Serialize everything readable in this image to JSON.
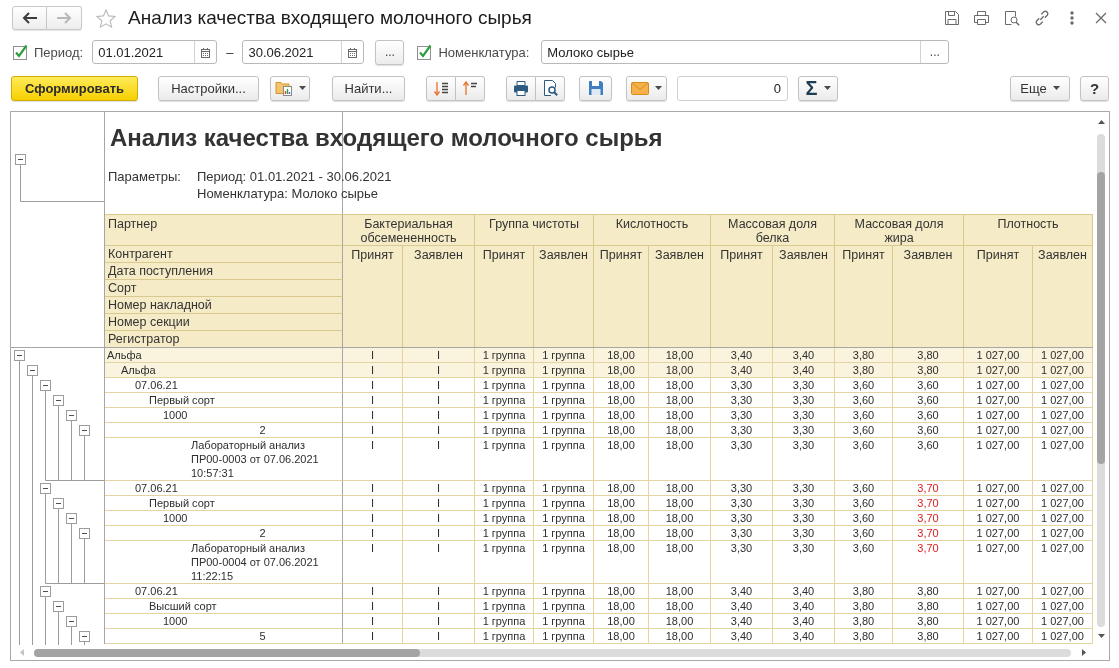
{
  "window": {
    "navigation": [
      {
        "kind": "back",
        "disabled": false
      },
      {
        "kind": "forward",
        "disabled": true
      }
    ],
    "favorite": false,
    "title": "Анализ качества входящего молочного сырья"
  },
  "filters": {
    "period": {
      "checked": true,
      "label": "Период:",
      "from": "01.01.2021",
      "separator": "–",
      "to": "30.06.2021",
      "choose_button": "..."
    },
    "nomenclature": {
      "checked": true,
      "label": "Номенклатура:",
      "value": "Молоко сырье",
      "choose_button": "..."
    }
  },
  "command_bar": {
    "generate_button": "Сформировать",
    "settings_button": "Настройки...",
    "find_button": "Найти...",
    "counter": "0",
    "sum_button": "Σ",
    "more_button": "Еще",
    "help_button": "?"
  },
  "report": {
    "title": "Анализ качества входящего молочного сырья",
    "parameters": {
      "expanded": true,
      "label": "Параметры:",
      "lines": [
        "Период: 01.01.2021 - 30.06.2021",
        "Номенклатура: Молоко сырье"
      ]
    },
    "group_header": "Партнер",
    "level_headers": [
      "Контрагент",
      "Дата поступления",
      "Сорт",
      "Номер накладной",
      "Номер секции",
      "Регистратор"
    ],
    "column_groups": [
      {
        "title": "Бактериальная обсемененность",
        "columns": [
          "Принят",
          "Заявлен"
        ]
      },
      {
        "title": "Группа чистоты",
        "columns": [
          "Принят",
          "Заявлен"
        ]
      },
      {
        "title": "Кислотность",
        "columns": [
          "Принят",
          "Заявлен"
        ]
      },
      {
        "title": "Массовая доля белка",
        "columns": [
          "Принят",
          "Заявлен"
        ]
      },
      {
        "title": "Массовая доля жира",
        "columns": [
          "Принят",
          "Заявлен"
        ]
      },
      {
        "title": "Плотность",
        "columns": [
          "Принят",
          "Заявлен"
        ]
      }
    ],
    "rows": [
      {
        "label": "Альфа",
        "expanded": true,
        "declared_fat_mismatch": false,
        "values": [
          "I",
          "I",
          "1 группа",
          "1 группа",
          "18,00",
          "18,00",
          "3,40",
          "3,40",
          "3,80",
          "3,80",
          "1 027,00",
          "1 027,00"
        ],
        "children": [
          {
            "label": "Альфа",
            "expanded": true,
            "declared_fat_mismatch": false,
            "values": [
              "I",
              "I",
              "1 группа",
              "1 группа",
              "18,00",
              "18,00",
              "3,40",
              "3,40",
              "3,80",
              "3,80",
              "1 027,00",
              "1 027,00"
            ],
            "children": [
              {
                "label": "07.06.21",
                "expanded": true,
                "declared_fat_mismatch": false,
                "values": [
                  "I",
                  "I",
                  "1 группа",
                  "1 группа",
                  "18,00",
                  "18,00",
                  "3,30",
                  "3,30",
                  "3,60",
                  "3,60",
                  "1 027,00",
                  "1 027,00"
                ],
                "children": [
                  {
                    "label": "Первый сорт",
                    "expanded": true,
                    "declared_fat_mismatch": false,
                    "values": [
                      "I",
                      "I",
                      "1 группа",
                      "1 группа",
                      "18,00",
                      "18,00",
                      "3,30",
                      "3,30",
                      "3,60",
                      "3,60",
                      "1 027,00",
                      "1 027,00"
                    ],
                    "children": [
                      {
                        "label": "1000",
                        "expanded": true,
                        "declared_fat_mismatch": false,
                        "values": [
                          "I",
                          "I",
                          "1 группа",
                          "1 группа",
                          "18,00",
                          "18,00",
                          "3,30",
                          "3,30",
                          "3,60",
                          "3,60",
                          "1 027,00",
                          "1 027,00"
                        ],
                        "children": [
                          {
                            "label": "2",
                            "expanded": true,
                            "declared_fat_mismatch": false,
                            "values": [
                              "I",
                              "I",
                              "1 группа",
                              "1 группа",
                              "18,00",
                              "18,00",
                              "3,30",
                              "3,30",
                              "3,60",
                              "3,60",
                              "1 027,00",
                              "1 027,00"
                            ],
                            "children": [
                              {
                                "label": "Лабораторный анализ ПР00-0003 от 07.06.2021 10:57:31",
                                "declared_fat_mismatch": false,
                                "values": [
                                  "I",
                                  "I",
                                  "1 группа",
                                  "1 группа",
                                  "18,00",
                                  "18,00",
                                  "3,30",
                                  "3,30",
                                  "3,60",
                                  "3,60",
                                  "1 027,00",
                                  "1 027,00"
                                ]
                              }
                            ]
                          }
                        ]
                      }
                    ]
                  }
                ]
              },
              {
                "label": "07.06.21",
                "expanded": true,
                "declared_fat_mismatch": true,
                "values": [
                  "I",
                  "I",
                  "1 группа",
                  "1 группа",
                  "18,00",
                  "18,00",
                  "3,30",
                  "3,30",
                  "3,60",
                  "3,70",
                  "1 027,00",
                  "1 027,00"
                ],
                "children": [
                  {
                    "label": "Первый сорт",
                    "expanded": true,
                    "declared_fat_mismatch": true,
                    "values": [
                      "I",
                      "I",
                      "1 группа",
                      "1 группа",
                      "18,00",
                      "18,00",
                      "3,30",
                      "3,30",
                      "3,60",
                      "3,70",
                      "1 027,00",
                      "1 027,00"
                    ],
                    "children": [
                      {
                        "label": "1000",
                        "expanded": true,
                        "declared_fat_mismatch": true,
                        "values": [
                          "I",
                          "I",
                          "1 группа",
                          "1 группа",
                          "18,00",
                          "18,00",
                          "3,30",
                          "3,30",
                          "3,60",
                          "3,70",
                          "1 027,00",
                          "1 027,00"
                        ],
                        "children": [
                          {
                            "label": "2",
                            "expanded": true,
                            "declared_fat_mismatch": true,
                            "values": [
                              "I",
                              "I",
                              "1 группа",
                              "1 группа",
                              "18,00",
                              "18,00",
                              "3,30",
                              "3,30",
                              "3,60",
                              "3,70",
                              "1 027,00",
                              "1 027,00"
                            ],
                            "children": [
                              {
                                "label": "Лабораторный анализ ПР00-0004 от 07.06.2021 11:22:15",
                                "declared_fat_mismatch": true,
                                "values": [
                                  "I",
                                  "I",
                                  "1 группа",
                                  "1 группа",
                                  "18,00",
                                  "18,00",
                                  "3,30",
                                  "3,30",
                                  "3,60",
                                  "3,70",
                                  "1 027,00",
                                  "1 027,00"
                                ]
                              }
                            ]
                          }
                        ]
                      }
                    ]
                  }
                ]
              },
              {
                "label": "07.06.21",
                "expanded": true,
                "declared_fat_mismatch": false,
                "values": [
                  "I",
                  "I",
                  "1 группа",
                  "1 группа",
                  "18,00",
                  "18,00",
                  "3,40",
                  "3,40",
                  "3,80",
                  "3,80",
                  "1 027,00",
                  "1 027,00"
                ],
                "children": [
                  {
                    "label": "Высший сорт",
                    "expanded": true,
                    "declared_fat_mismatch": false,
                    "values": [
                      "I",
                      "I",
                      "1 группа",
                      "1 группа",
                      "18,00",
                      "18,00",
                      "3,40",
                      "3,40",
                      "3,80",
                      "3,80",
                      "1 027,00",
                      "1 027,00"
                    ],
                    "children": [
                      {
                        "label": "1000",
                        "expanded": true,
                        "declared_fat_mismatch": false,
                        "values": [
                          "I",
                          "I",
                          "1 группа",
                          "1 группа",
                          "18,00",
                          "18,00",
                          "3,40",
                          "3,40",
                          "3,80",
                          "3,80",
                          "1 027,00",
                          "1 027,00"
                        ],
                        "children": [
                          {
                            "label": "5",
                            "expanded": true,
                            "declared_fat_mismatch": false,
                            "values": [
                              "I",
                              "I",
                              "1 группа",
                              "1 группа",
                              "18,00",
                              "18,00",
                              "3,40",
                              "3,40",
                              "3,80",
                              "3,80",
                              "1 027,00",
                              "1 027,00"
                            ]
                          }
                        ]
                      }
                    ]
                  }
                ]
              }
            ]
          }
        ]
      }
    ]
  }
}
